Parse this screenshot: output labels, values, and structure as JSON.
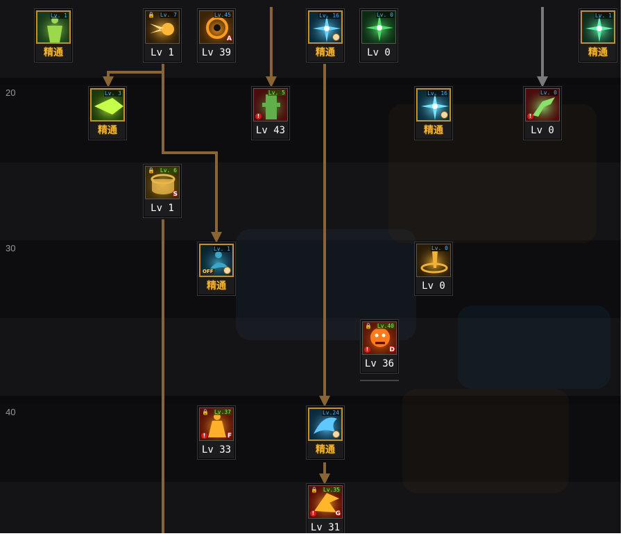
{
  "rows": [
    {
      "label": ""
    },
    {
      "label": "20"
    },
    {
      "label": ""
    },
    {
      "label": "30"
    },
    {
      "label": ""
    },
    {
      "label": "40"
    },
    {
      "label": ""
    }
  ],
  "colors": {
    "arrow_brown": "#8b6434",
    "arrow_gray": "#7a7a7a",
    "mastered_text": "#f2b62c",
    "level_text": "#ffffff"
  },
  "skills": [
    {
      "name": "body-aura",
      "icon": "muscle-body-icon",
      "tag": "Lv. 1",
      "tag_style": "blue",
      "caption": "精通",
      "mastered": true,
      "locked": false,
      "grade": "",
      "warn": false,
      "clock": false,
      "off": false,
      "palette": [
        "#173a1a",
        "#9bd94a"
      ]
    },
    {
      "name": "fire-blast",
      "icon": "fireball-icon",
      "tag": "Lv. 7",
      "tag_style": "blue",
      "caption": "Lv 1",
      "mastered": false,
      "locked": true,
      "grade": "",
      "warn": false,
      "clock": false,
      "off": false,
      "palette": [
        "#2a1c08",
        "#ffb536"
      ]
    },
    {
      "name": "vortex",
      "icon": "vortex-icon",
      "tag": "Lv.45",
      "tag_style": "blue",
      "caption": "Lv 39",
      "mastered": false,
      "locked": false,
      "grade": "A",
      "warn": false,
      "clock": false,
      "off": false,
      "palette": [
        "#3a2306",
        "#ff9b1f"
      ]
    },
    {
      "name": "ice-spark",
      "icon": "ice-burst-icon",
      "tag": "Lv. 16",
      "tag_style": "blue",
      "caption": "精通",
      "mastered": true,
      "locked": false,
      "grade": "",
      "warn": false,
      "clock": true,
      "off": false,
      "palette": [
        "#082a3a",
        "#6ad6ff"
      ]
    },
    {
      "name": "green-burst",
      "icon": "green-burst-icon",
      "tag": "Lv. 0",
      "tag_style": "blue",
      "caption": "Lv 0",
      "mastered": false,
      "locked": false,
      "grade": "",
      "warn": false,
      "clock": false,
      "off": false,
      "palette": [
        "#0d2a12",
        "#4ee06a"
      ]
    },
    {
      "name": "green-star",
      "icon": "green-star-icon",
      "tag": "Lv. 1",
      "tag_style": "blue",
      "caption": "精通",
      "mastered": true,
      "locked": false,
      "grade": "",
      "warn": false,
      "clock": false,
      "off": false,
      "palette": [
        "#0f2a1c",
        "#62f2b0"
      ]
    },
    {
      "name": "energy-wave",
      "icon": "energy-wave-icon",
      "tag": "Lv. 3",
      "tag_style": "blue",
      "caption": "精通",
      "mastered": true,
      "locked": false,
      "grade": "",
      "warn": false,
      "clock": false,
      "off": false,
      "palette": [
        "#1c3a08",
        "#c6ff4a"
      ]
    },
    {
      "name": "stone-statue",
      "icon": "statue-icon",
      "tag": "Lv. 5",
      "tag_style": "green",
      "caption": "Lv 43",
      "mastered": false,
      "locked": false,
      "grade": "",
      "warn": true,
      "clock": false,
      "off": false,
      "palette": [
        "#4a0c0c",
        "#5fb04a"
      ]
    },
    {
      "name": "ice-flash",
      "icon": "ice-flash-icon",
      "tag": "Lv. 16",
      "tag_style": "blue",
      "caption": "精通",
      "mastered": true,
      "locked": false,
      "grade": "",
      "warn": false,
      "clock": true,
      "off": false,
      "palette": [
        "#082a3a",
        "#74e6ff"
      ]
    },
    {
      "name": "green-kick",
      "icon": "kick-icon",
      "tag": "Lv. 0",
      "tag_style": "blue",
      "caption": "Lv 0",
      "mastered": false,
      "locked": false,
      "grade": "",
      "warn": true,
      "clock": false,
      "off": false,
      "palette": [
        "#4a0c0c",
        "#8be06a"
      ]
    },
    {
      "name": "golden-ring",
      "icon": "golden-ring-icon",
      "tag": "Lv. 6",
      "tag_style": "green",
      "caption": "Lv 1",
      "mastered": false,
      "locked": true,
      "grade": "S",
      "warn": false,
      "clock": false,
      "off": false,
      "palette": [
        "#3a2a06",
        "#e8b64a"
      ]
    },
    {
      "name": "water-guard",
      "icon": "water-guard-icon",
      "tag": "Lv. 1",
      "tag_style": "blue",
      "caption": "精通",
      "mastered": true,
      "locked": false,
      "grade": "",
      "warn": false,
      "clock": true,
      "off": true,
      "off_label": "OFF",
      "palette": [
        "#0a2230",
        "#3aa6c8"
      ]
    },
    {
      "name": "sand-swirl",
      "icon": "sand-swirl-icon",
      "tag": "Lv. 0",
      "tag_style": "blue",
      "caption": "Lv 0",
      "mastered": false,
      "locked": false,
      "grade": "",
      "warn": false,
      "clock": false,
      "off": false,
      "palette": [
        "#2a1c06",
        "#f2b236"
      ]
    },
    {
      "name": "flame-demon",
      "icon": "demon-icon",
      "tag": "Lv.40",
      "tag_style": "green",
      "caption": "Lv 36",
      "mastered": false,
      "locked": true,
      "grade": "D",
      "warn": true,
      "clock": false,
      "off": false,
      "palette": [
        "#5a1606",
        "#ff7a1a"
      ]
    },
    {
      "name": "fire-warrior",
      "icon": "fire-warrior-icon",
      "tag": "Lv.37",
      "tag_style": "green",
      "caption": "Lv 33",
      "mastered": false,
      "locked": true,
      "grade": "F",
      "warn": true,
      "clock": false,
      "off": false,
      "palette": [
        "#5a1006",
        "#ffb02a"
      ]
    },
    {
      "name": "dragon-wave",
      "icon": "dragon-wave-icon",
      "tag": "Lv.24",
      "tag_style": "blue",
      "caption": "精通",
      "mastered": true,
      "locked": false,
      "grade": "",
      "warn": false,
      "clock": true,
      "off": false,
      "palette": [
        "#0a2a3c",
        "#5ec8ff"
      ]
    },
    {
      "name": "fire-strike",
      "icon": "fire-strike-icon",
      "tag": "Lv.35",
      "tag_style": "green",
      "caption": "Lv 31",
      "mastered": false,
      "locked": true,
      "grade": "G",
      "warn": true,
      "clock": false,
      "off": false,
      "palette": [
        "#5a0c06",
        "#ffb62a"
      ]
    }
  ]
}
